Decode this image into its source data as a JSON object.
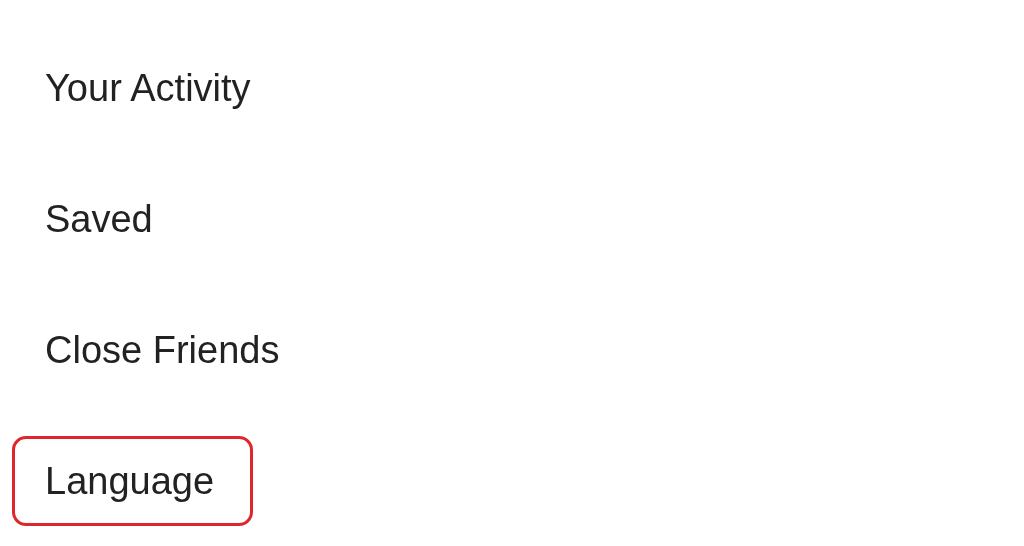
{
  "menu": {
    "items": [
      {
        "label": "Your Activity",
        "highlighted": false
      },
      {
        "label": "Saved",
        "highlighted": false
      },
      {
        "label": "Close Friends",
        "highlighted": false
      },
      {
        "label": "Language",
        "highlighted": true
      }
    ]
  }
}
